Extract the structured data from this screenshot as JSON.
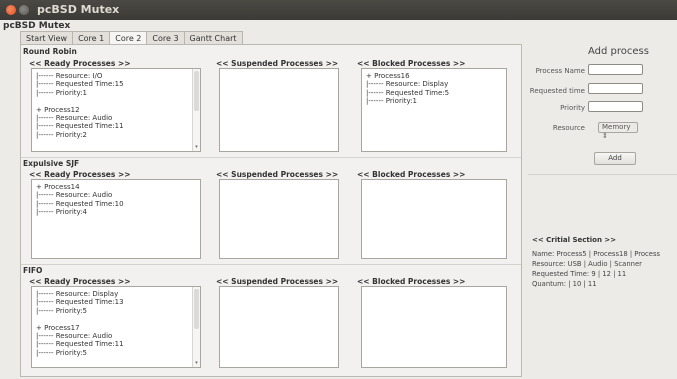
{
  "window": {
    "title": "pcBSD Mutex"
  },
  "app": {
    "title": "pcBSD Mutex"
  },
  "tabs": [
    "Start View",
    "Core 1",
    "Core 2",
    "Core 3",
    "Gantt Chart"
  ],
  "active_tab": "Core 2",
  "columns": {
    "ready": "<< Ready Processes >>",
    "suspended": "<< Suspended Processes >>",
    "blocked": "<< Blocked Processes >>"
  },
  "sections": {
    "round_robin": {
      "title": "Round Robin",
      "ready": "|------ Resource: I/O\n|------ Requested Time:15\n|------ Priority:1\n\n+ Process12\n|------ Resource: Audio\n|------ Requested Time:11\n|------ Priority:2",
      "blocked": "+ Process16\n|------ Resource: Display\n|------ Requested Time:5\n|------ Priority:1"
    },
    "sjf": {
      "title": "Expulsive SJF",
      "ready": "+ Process14\n|------ Resource: Audio\n|------ Requested Time:10\n|------ Priority:4"
    },
    "fifo": {
      "title": "FIFO",
      "ready": "|------ Resource: Display\n|------ Requested Time:13\n|------ Priority:5\n\n+ Process17\n|------ Resource: Audio\n|------ Requested Time:11\n|------ Priority:5"
    }
  },
  "add_process": {
    "title": "Add process",
    "process_name_label": "Process Name",
    "requested_time_label": "Requested time",
    "priority_label": "Priority",
    "resource_label": "Resource",
    "resource_value": "Memory",
    "add_button": "Add"
  },
  "critical_section": {
    "title": "<< Critial Section >>",
    "name_line": "Name: Process5 | Process18 | Process",
    "resource_line": "Resource: USB | Audio | Scanner",
    "time_line": "Requested Time: 9 | 12 | 11",
    "quantum_line": "Quantum:  | 10 | 11"
  }
}
